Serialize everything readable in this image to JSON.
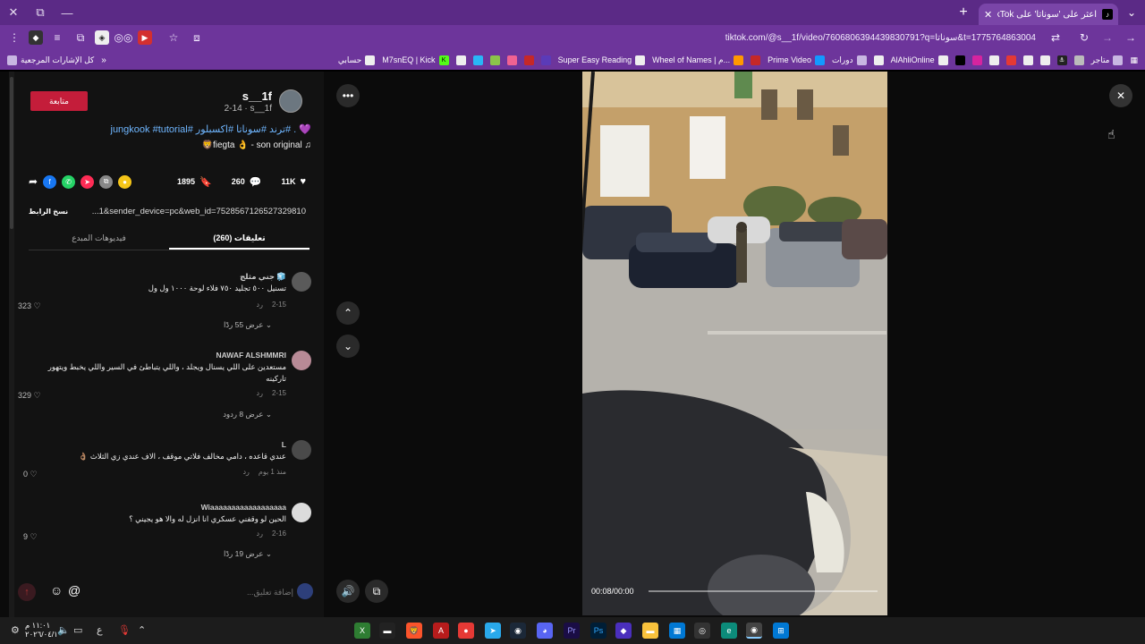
{
  "browser": {
    "tab_title": "اعثر على 'سوناتا' على TikTok",
    "url": "tiktok.com/@s__1f/video/7606806394439830791?q=سوناتا&t=1775764863004"
  },
  "bookmarks": {
    "all_bookmarks": "كل الإشارات المرجعية",
    "items": [
      "حسابي",
      "M7snEQ | Kick",
      "Super Easy Reading",
      "Wheel of Names | م...",
      "Prime Video",
      "دورات",
      "AlAhliOnline",
      "متاجر"
    ]
  },
  "post": {
    "follow_label": "متابعة",
    "username": "s__1f",
    "sub": "2-14 · s__1f",
    "description": "💜 . #ترند #سوناتا #اكسبلور #jungkook #tutorial",
    "music": "♫ fiegta 👌 - son original🦁",
    "likes": "11K",
    "comments": "260",
    "saves": "1895",
    "copy_link": "نسخ الرابط",
    "link": "...1&sender_device=pc&web_id=7528567126527329810",
    "tab_comments": "(260) تعليقات",
    "tab_creator_videos": "فيديوهات المبدع"
  },
  "comments": [
    {
      "name": "جني مثلج 🧊",
      "text": "تسنيل ٥٠٠ تجليد ٧٥٠ فلاء لوحة ١٠٠٠ ول ول",
      "date": "2-15",
      "reply": "رد",
      "likes": "323",
      "replies_label": "عرض 55 ردًا",
      "avatar_color": "#5a5a5a"
    },
    {
      "name": "NAWAF ALSHMMRI",
      "text": "مستعدين على اللي يسنال ويجلد ، واللي يتباطئ في السير واللي يخبط ويتهور تاركينه",
      "date": "2-15",
      "reply": "رد",
      "likes": "329",
      "replies_label": "عرض 8 ردود",
      "avatar_color": "#b88a96"
    },
    {
      "name": "L",
      "text": "عندي قاعده ، دامي مخالف فلاتي موقف ، الاف عندي زي الثلاث 👌🏽",
      "date": "منذ 1 يوم",
      "reply": "رد",
      "likes": "0",
      "replies_label": "",
      "avatar_color": "#4a4a4a"
    },
    {
      "name": "Wiaaaaaaaaaaaaaaaaaa",
      "text": "الحين لو وقفني عسكري انا انزل له والا هو يجيني ؟",
      "date": "2-16",
      "reply": "رد",
      "likes": "9",
      "replies_label": "عرض 19 ردًا",
      "avatar_color": "#dcdcdc"
    }
  ],
  "composer": {
    "placeholder": "إضافة تعليق..."
  },
  "video": {
    "time": "00:08/00:00"
  },
  "taskbar": {
    "time": "١١:٠١ م",
    "date": "٢٠٢٦/٠٤/١٠",
    "lang": "ع"
  },
  "colors": {
    "titlebar": "#5b2a86",
    "toolbar": "#6d359b",
    "follow": "#c41d3a",
    "hashtag": "#6fb6ff"
  }
}
